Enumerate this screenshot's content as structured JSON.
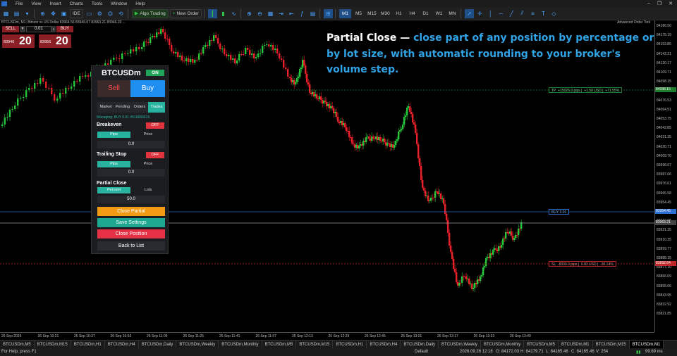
{
  "menubar": {
    "items": [
      "File",
      "View",
      "Insert",
      "Charts",
      "Tools",
      "Window",
      "Help"
    ]
  },
  "toolbar": {
    "ide_label": "IDE",
    "algo_trading_label": "Algo Trading",
    "new_order_label": "New Order",
    "timeframes": [
      "M1",
      "M5",
      "M15",
      "M30",
      "H1",
      "H4",
      "D1",
      "W1",
      "MN"
    ],
    "active_timeframe": "M1"
  },
  "chart": {
    "title": "BTCUSDm, M1: Bitcoin vs US Dollar  83964.56 83949.07 83963.21 83946.20 ...",
    "advanced_tool_label": "Advanced Order Tool",
    "overlay_title": "Partial Close —",
    "overlay_text": " close part of any position by percentage or by lot size, with automatic rounding to your broker's volume step.",
    "tp_tag": {
      "prefix": "TP",
      "pips": "+15026.0 pips",
      "usd": "+1.50 USD",
      "pct": "+71.55%"
    },
    "buy_tag": "BUY 0.01",
    "sl_tag": {
      "prefix": "SL",
      "pips": "-8330.0 pips",
      "usd": "0.83 USD",
      "pct": "-30.14%"
    },
    "price_labels": [
      "84186.50",
      "84175.19",
      "84153.85",
      "84142.21",
      "84120.17",
      "84109.71",
      "84098.15",
      "84087.05",
      "84076.53",
      "84064.51",
      "84053.75",
      "84042.85",
      "84031.35",
      "84020.71",
      "84009.70",
      "83998.67",
      "83987.66",
      "83976.61",
      "83965.58",
      "83954.45",
      "83943.54",
      "83932.95",
      "83921.35",
      "83910.35",
      "83899.77",
      "83888.15",
      "83877.10",
      "83866.09",
      "83855.06",
      "83843.95",
      "83832.92",
      "83821.85"
    ],
    "price_tags": {
      "tp": "84098.15",
      "bid": "83963.21",
      "buy": "83954.45",
      "sl": "83892.64"
    },
    "time_labels": [
      "26 Sep 2026",
      "26 Sep 10:21",
      "26 Sep 10:37",
      "26 Sep 10:53",
      "26 Sep 11:09",
      "26 Sep 11:25",
      "26 Sep 11:41",
      "26 Sep 11:57",
      "26 Sep 12:13",
      "26 Sep 12:29",
      "26 Sep 12:45",
      "26 Sep 13:01",
      "26 Sep 13:17",
      "26 Sep 13:33",
      "26 Sep 13:49"
    ],
    "colors": {
      "bull": "#26c53a",
      "bear": "#e8202a",
      "tp_line": "#1e7d2e",
      "buy_line": "#2c6fd1",
      "sl_line": "#c0282a",
      "bid_line": "#9a9a9a",
      "overlay_accent": "#2fa3e6"
    }
  },
  "one_click": {
    "sell_label": "SELL",
    "volume": "0.01",
    "buy_label": "BUY",
    "sell_small": "83946",
    "sell_big": "20",
    "buy_small": "83956",
    "buy_big": "20"
  },
  "panel": {
    "symbol": "BTCUSDm",
    "status": "ON",
    "sell_label": "Sell",
    "buy_label": "Buy",
    "tabs": [
      "Market",
      "Pending",
      "Orders",
      "Trades"
    ],
    "active_tab": "Trades",
    "managing_text": "Managing: BUY 0.01 #516666615",
    "breakeven": {
      "title": "Breakeven",
      "state": "OFF",
      "mode_a": "Pips",
      "mode_b": "Price",
      "value": "0.0"
    },
    "trailing": {
      "title": "Trailing Stop",
      "state": "OFF",
      "mode_a": "Pips",
      "mode_b": "Price",
      "value": "0.0"
    },
    "partial": {
      "title": "Partial Close",
      "mode_a": "Percent",
      "mode_b": "Lots",
      "value": "50.0"
    },
    "actions": {
      "close_partial": "Close Partial",
      "save_settings": "Save Settings",
      "close_position": "Close Position",
      "back": "Back to List"
    }
  },
  "tabs": [
    "BTCUSDm,M5",
    "BTCUSDm,M15",
    "BTCUSDm,H1",
    "BTCUSDm,H4",
    "BTCUSDm,Daily",
    "BTCUSDm,Weekly",
    "BTCUSDm,Monthly",
    "BTCUSDm,M5",
    "BTCUSDm,M15",
    "BTCUSDm,H1",
    "BTCUSDm,H4",
    "BTCUSDm,Daily",
    "BTCUSDm,Weekly",
    "BTCUSDm,Monthly",
    "BTCUSDm,M5",
    "BTCUSDm,M1",
    "BTCUSDm,M15",
    "BTCUSDm,M1"
  ],
  "active_tab_index": 17,
  "statusbar": {
    "help": "For Help, press F1",
    "profile": "Default",
    "datetime": "2026.09.26 12:18",
    "open": "O: 84172.03",
    "high": "H: 84179.71",
    "low": "L: 84165.46",
    "close": "C: 84165.46",
    "volume": "V: 254",
    "ping": "99.69 ms"
  }
}
